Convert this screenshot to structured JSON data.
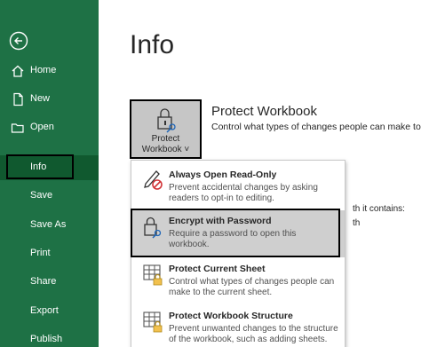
{
  "sidebar": {
    "back_icon": "back-arrow-icon",
    "items": [
      {
        "label": "Home",
        "icon": "home-icon"
      },
      {
        "label": "New",
        "icon": "new-document-icon"
      },
      {
        "label": "Open",
        "icon": "folder-icon"
      },
      {
        "label": "Info"
      },
      {
        "label": "Save"
      },
      {
        "label": "Save As"
      },
      {
        "label": "Print"
      },
      {
        "label": "Share"
      },
      {
        "label": "Export"
      },
      {
        "label": "Publish"
      }
    ],
    "selected": "Info"
  },
  "main": {
    "title": "Info",
    "protect_button": {
      "line1": "Protect",
      "line2": "Workbook ˅"
    },
    "section_heading": "Protect Workbook",
    "section_desc": "Control what types of changes people can make to this",
    "background_text_1": "th it contains:",
    "background_text_2": "th"
  },
  "menu": {
    "items": [
      {
        "title": "Always Open Read-Only",
        "desc1": "Prevent accidental changes by asking",
        "desc2": "readers to opt-in to editing.",
        "icon": "pencil-prohibited-icon"
      },
      {
        "title": "Encrypt with Password",
        "desc1": "Require a password to open this",
        "desc2": "workbook.",
        "icon": "lock-key-icon"
      },
      {
        "title": "Protect Current Sheet",
        "desc1": "Control what types of changes people can",
        "desc2": "make to the current sheet.",
        "icon": "sheet-lock-icon"
      },
      {
        "title": "Protect Workbook Structure",
        "desc1": "Prevent unwanted changes to the structure",
        "desc2": "of the workbook, such as adding sheets.",
        "icon": "workbook-lock-icon"
      }
    ]
  },
  "colors": {
    "sidebar": "#1e7145",
    "selected": "#10592f",
    "highlight": "#cfcfcf"
  }
}
